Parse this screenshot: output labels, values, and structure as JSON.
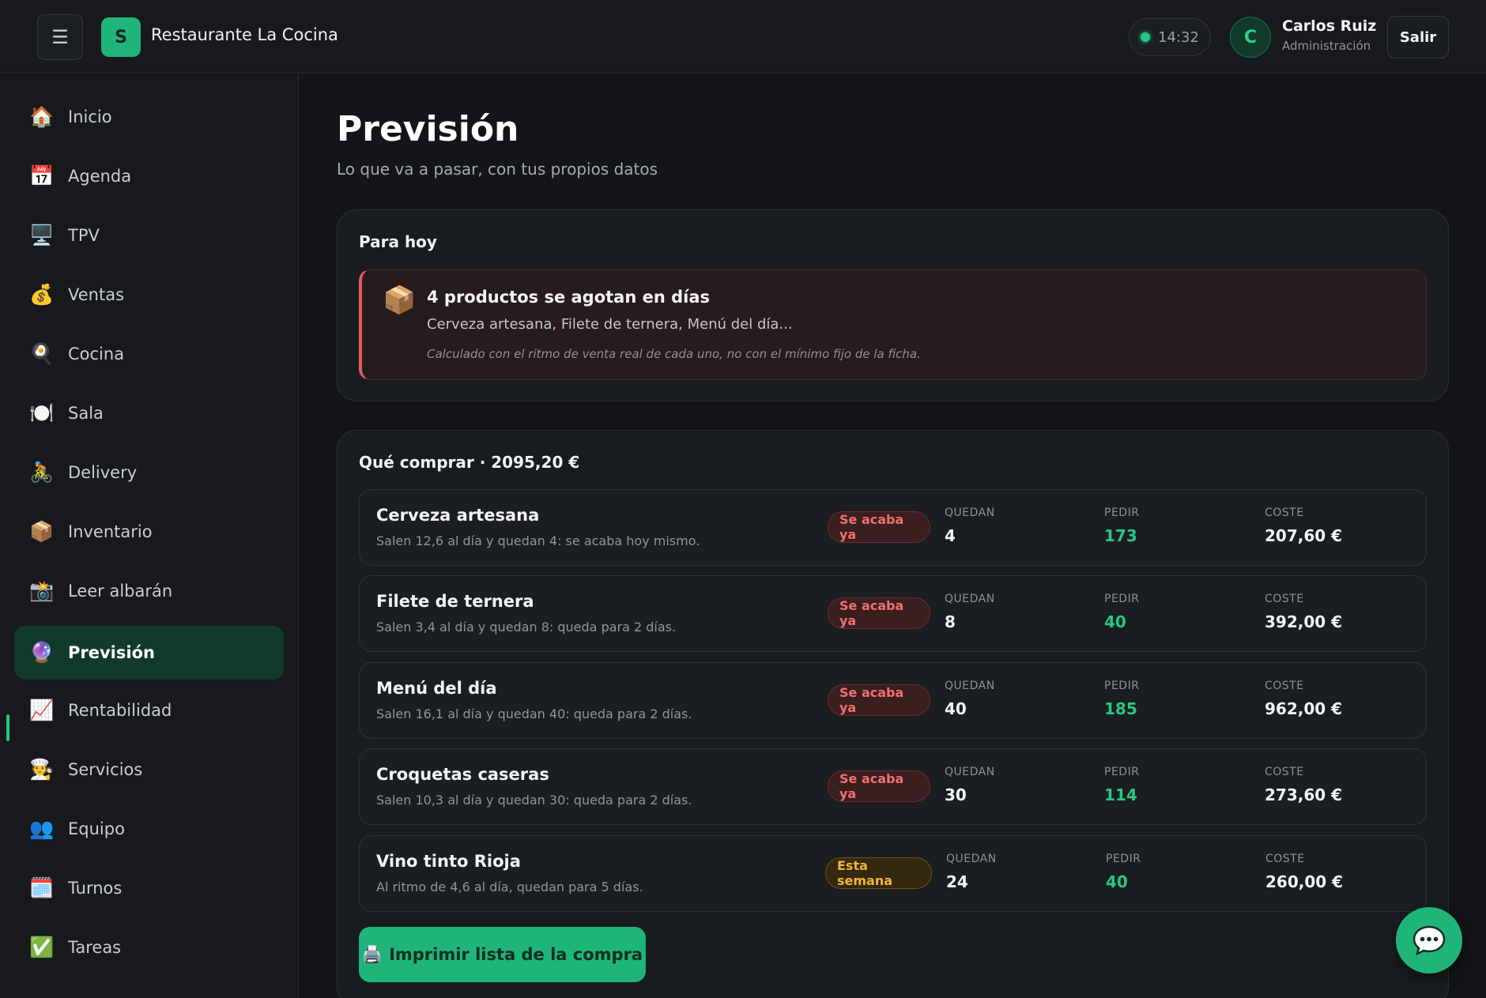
{
  "header": {
    "menu_icon": "☰",
    "logo_letter": "S",
    "app_title": "Restaurante La Cocina",
    "clock": "14:32",
    "user": {
      "initial": "C",
      "name": "Carlos Ruiz",
      "role": "Administración"
    },
    "logout_label": "Salir"
  },
  "sidebar": {
    "items": [
      {
        "icon": "🏠",
        "label": "Inicio"
      },
      {
        "icon": "📅",
        "label": "Agenda"
      },
      {
        "icon": "🖥️",
        "label": "TPV"
      },
      {
        "icon": "💰",
        "label": "Ventas"
      },
      {
        "icon": "🍳",
        "label": "Cocina"
      },
      {
        "icon": "🍽️",
        "label": "Sala"
      },
      {
        "icon": "🚴",
        "label": "Delivery"
      },
      {
        "icon": "📦",
        "label": "Inventario"
      },
      {
        "icon": "📸",
        "label": "Leer albarán"
      },
      {
        "icon": "🔮",
        "label": "Previsión",
        "active": true
      },
      {
        "icon": "📈",
        "label": "Rentabilidad"
      },
      {
        "icon": "🧑‍🍳",
        "label": "Servicios"
      },
      {
        "icon": "👥",
        "label": "Equipo"
      },
      {
        "icon": "🗓️",
        "label": "Turnos"
      },
      {
        "icon": "✅",
        "label": "Tareas"
      }
    ]
  },
  "main": {
    "title": "Previsión",
    "subtitle": "Lo que va a pasar, con tus propios datos",
    "today": {
      "title": "Para hoy",
      "alert": {
        "icon": "📦",
        "title": "4 productos se agotan en días",
        "items": "Cerveza artesana, Filete de ternera, Menú del día...",
        "note": "Calculado con el ritmo de venta real de cada uno, no con el mínimo fijo de la ficha."
      }
    },
    "buy": {
      "title": "Qué comprar · 2095,20 €",
      "col_labels": {
        "left": "QUEDAN",
        "order": "PEDIR",
        "cost": "COSTE"
      },
      "rows": [
        {
          "name": "Cerveza artesana",
          "desc": "Salen 12,6 al día y quedan 4: se acaba hoy mismo.",
          "badge": "Se acaba ya",
          "left": "4",
          "order": "173",
          "cost": "207,60 €"
        },
        {
          "name": "Filete de ternera",
          "desc": "Salen 3,4 al día y quedan 8: queda para 2 días.",
          "badge": "Se acaba ya",
          "left": "8",
          "order": "40",
          "cost": "392,00 €"
        },
        {
          "name": "Menú del día",
          "desc": "Salen 16,1 al día y quedan 40: queda para 2 días.",
          "badge": "Se acaba ya",
          "left": "40",
          "order": "185",
          "cost": "962,00 €"
        },
        {
          "name": "Croquetas caseras",
          "desc": "Salen 10,3 al día y quedan 30: queda para 2 días.",
          "badge": "Se acaba ya",
          "left": "30",
          "order": "114",
          "cost": "273,60 €"
        },
        {
          "name": "Vino tinto Rioja",
          "desc": "Al ritmo de 4,6 al día, quedan para 5 días.",
          "badge": "Esta semana",
          "left": "24",
          "order": "40",
          "cost": "260,00 €"
        }
      ],
      "print_icon": "🖨️",
      "print_label": "Imprimir lista de la compra"
    }
  },
  "chat_icon": "chat-bubble-icon",
  "colors": {
    "accent": "#1fb57a",
    "danger": "#f07070",
    "warning": "#f0b43c",
    "background": "#131518"
  }
}
